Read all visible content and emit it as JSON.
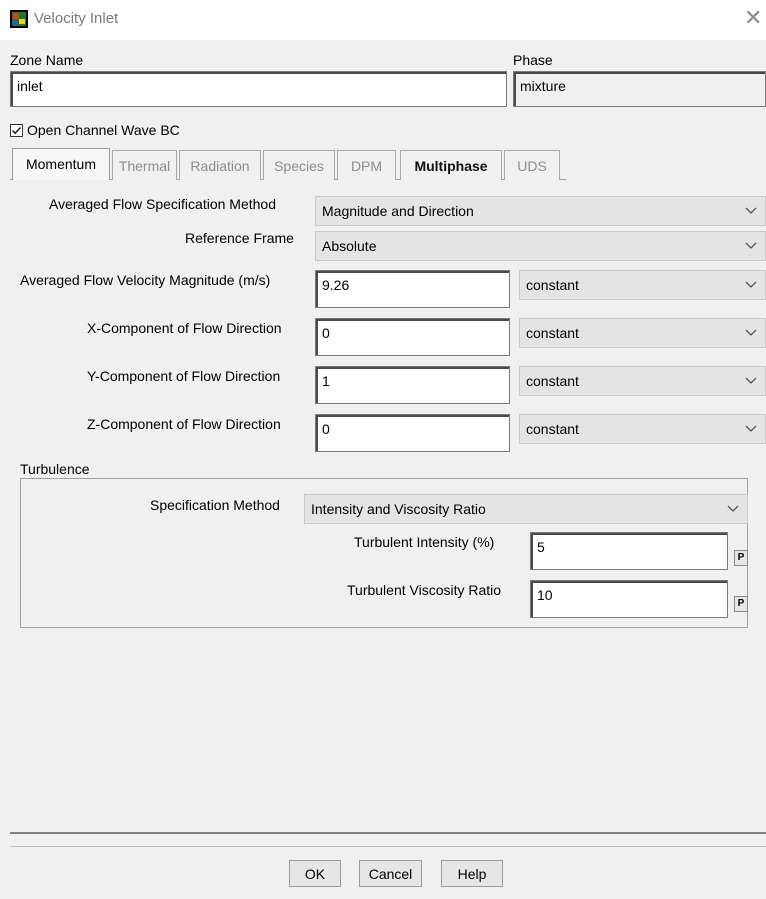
{
  "window": {
    "title": "Velocity Inlet",
    "icon": "fluent-app-icon",
    "close_glyph": "✕"
  },
  "zone": {
    "label": "Zone Name",
    "value": "inlet"
  },
  "phase": {
    "label": "Phase",
    "value": "mixture"
  },
  "open_channel": {
    "label": "Open Channel Wave BC",
    "checked": true
  },
  "tabs": [
    {
      "label": "Momentum",
      "state": "selected"
    },
    {
      "label": "Thermal",
      "state": "disabled"
    },
    {
      "label": "Radiation",
      "state": "disabled"
    },
    {
      "label": "Species",
      "state": "disabled"
    },
    {
      "label": "DPM",
      "state": "disabled"
    },
    {
      "label": "Multiphase",
      "state": "bold"
    },
    {
      "label": "UDS",
      "state": "disabled"
    }
  ],
  "momentum": {
    "spec_method": {
      "label": "Averaged Flow Specification Method",
      "value": "Magnitude and Direction"
    },
    "ref_frame": {
      "label": "Reference Frame",
      "value": "Absolute"
    },
    "velocity": {
      "label": "Averaged Flow Velocity Magnitude (m/s)",
      "value": "9.26",
      "profile": "constant"
    },
    "x_dir": {
      "label": "X-Component of Flow Direction",
      "value": "0",
      "profile": "constant"
    },
    "y_dir": {
      "label": "Y-Component of Flow Direction",
      "value": "1",
      "profile": "constant"
    },
    "z_dir": {
      "label": "Z-Component of Flow Direction",
      "value": "0",
      "profile": "constant"
    }
  },
  "turbulence": {
    "title": "Turbulence",
    "spec_method": {
      "label": "Specification Method",
      "value": "Intensity and Viscosity Ratio"
    },
    "intensity": {
      "label": "Turbulent Intensity (%)",
      "value": "5",
      "param": "P"
    },
    "viscosity_ratio": {
      "label": "Turbulent Viscosity Ratio",
      "value": "10",
      "param": "P"
    }
  },
  "buttons": {
    "ok": "OK",
    "cancel": "Cancel",
    "help": "Help"
  }
}
